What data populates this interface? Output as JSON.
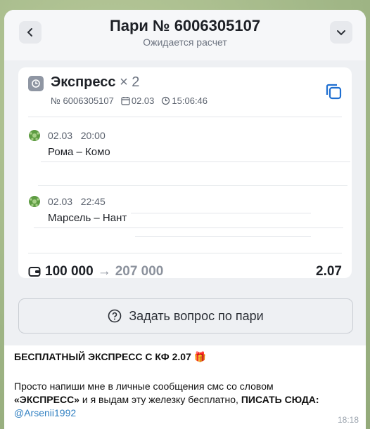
{
  "header": {
    "title": "Пари № 6006305107",
    "subtitle": "Ожидается расчет"
  },
  "bet": {
    "type": "Экспресс",
    "multiplier": "× 2",
    "number": "№ 6006305107",
    "date": "02.03",
    "time": "15:06:46",
    "events": [
      {
        "date": "02.03",
        "time": "20:00",
        "teams": "Рома – Комо"
      },
      {
        "date": "02.03",
        "time": "22:45",
        "teams": "Марсель – Нант"
      }
    ],
    "stake": "100 000",
    "arrow": "→",
    "potential_win": "207 000",
    "odds": "2.07"
  },
  "ask_button": {
    "label": "Задать вопрос по пари"
  },
  "message": {
    "headline": "БЕСПЛАТНЫЙ ЭКСПРЕСС С КФ 2.07",
    "headline_emoji": "🎁",
    "body_1": "Просто напиши мне в личные сообщения смс со словом",
    "body_keyword": "«ЭКСПРЕСС»",
    "body_2": " и я выдам эту железку бесплатно, ",
    "body_cta": "ПИСАТЬ СЮДА:",
    "mention": "@Arsenii1992",
    "time": "18:18"
  },
  "colors": {
    "accent": "#1f6fd1",
    "wallpaper": "#a9bd8f"
  },
  "icons": [
    "chevron-left-icon",
    "chevron-down-icon",
    "clock-icon",
    "calendar-icon",
    "copy-icon",
    "soccer-ball-icon",
    "wallet-icon",
    "question-icon"
  ]
}
